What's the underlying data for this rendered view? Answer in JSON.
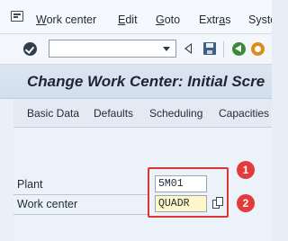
{
  "menu": {
    "items": [
      {
        "acc": "W",
        "rest": "ork center"
      },
      {
        "acc": "E",
        "rest": "dit"
      },
      {
        "acc": "G",
        "rest": "oto"
      },
      {
        "acc": "",
        "rest": "Extr",
        "acc_mid": "a",
        "rest2": "s"
      },
      {
        "acc": "",
        "rest": "Syste"
      }
    ]
  },
  "toolbar": {
    "command_field_value": ""
  },
  "title": "Change Work Center: Initial Scre",
  "app_toolbar": {
    "buttons": [
      "Basic Data",
      "Defaults",
      "Scheduling",
      "Capacities"
    ]
  },
  "form": {
    "plant": {
      "label": "Plant",
      "value": "5M01"
    },
    "work_center": {
      "label": "Work center",
      "value": "QUADR"
    }
  },
  "callouts": [
    "1",
    "2"
  ],
  "colors": {
    "highlight": "#e03434",
    "callout": "#e23b3b",
    "required_field": "#fff7c9"
  }
}
